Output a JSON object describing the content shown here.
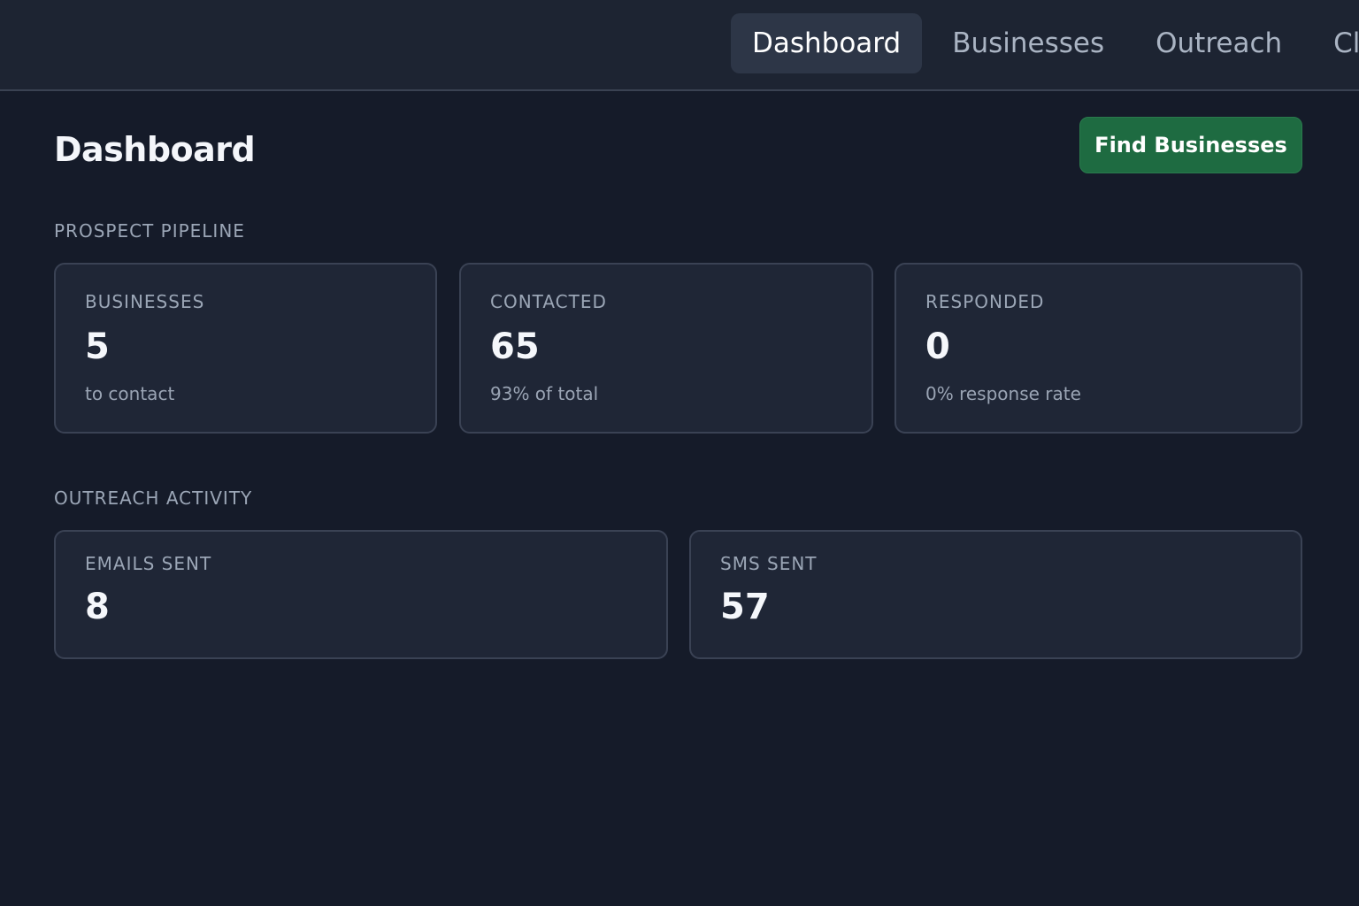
{
  "nav": {
    "tabs": [
      {
        "label": "Dashboard",
        "active": true
      },
      {
        "label": "Businesses",
        "active": false
      },
      {
        "label": "Outreach",
        "active": false
      },
      {
        "label": "Cli",
        "active": false
      }
    ]
  },
  "page": {
    "title": "Dashboard",
    "primary_button": "Find Businesses"
  },
  "pipeline": {
    "label": "PROSPECT PIPELINE",
    "cards": [
      {
        "label": "BUSINESSES",
        "value": "5",
        "sub": "to contact"
      },
      {
        "label": "CONTACTED",
        "value": "65",
        "sub": "93% of total"
      },
      {
        "label": "RESPONDED",
        "value": "0",
        "sub": "0% response rate"
      }
    ]
  },
  "activity": {
    "label": "OUTREACH ACTIVITY",
    "cards": [
      {
        "label": "EMAILS SENT",
        "value": "8"
      },
      {
        "label": "SMS SENT",
        "value": "57"
      }
    ]
  },
  "colors": {
    "background": "#151b29",
    "card": "#1f2636",
    "accent_green": "#1e6b41",
    "active_tab": "#2d3647"
  }
}
